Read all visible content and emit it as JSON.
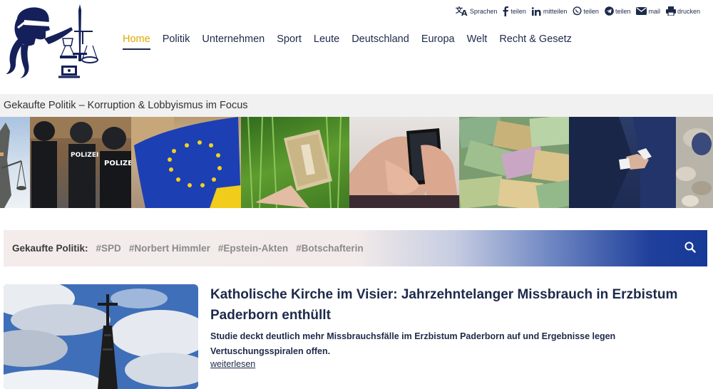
{
  "share": {
    "translate": "Sprachen",
    "facebook": "teilen",
    "linkedin": "mitteilen",
    "whatsapp": "teilen",
    "telegram": "teilen",
    "mail": "mail",
    "print": "drucken"
  },
  "nav": {
    "items": [
      "Home",
      "Politik",
      "Unternehmen",
      "Sport",
      "Leute",
      "Deutschland",
      "Europa",
      "Welt",
      "Recht & Gesetz"
    ]
  },
  "tagline": "Gekaufte Politik – Korruption & Lobbyismus im Focus",
  "banner": {
    "police_text": "POLIZEI"
  },
  "tagbar": {
    "label": "Gekaufte Politik:",
    "tags": [
      "#SPD",
      "#Norbert Himmler",
      "#Epstein-Akten",
      "#Botschafterin"
    ]
  },
  "article": {
    "title": "Katholische Kirche im Visier: Jahrzehntelanger Missbrauch in Erzbistum Paderborn enthüllt",
    "teaser": "Studie deckt deutlich mehr Missbrauchsfälle im Erzbistum Paderborn auf und Ergebnisse legen Vertuschungsspiralen offen.",
    "read_more": "weiterlesen"
  },
  "colors": {
    "navy": "#1d2a4a",
    "active_nav": "#e0a800",
    "tagbar_blue": "#173a97"
  },
  "icons": [
    "logo-justitia",
    "translate-icon",
    "facebook-icon",
    "linkedin-icon",
    "whatsapp-icon",
    "telegram-icon",
    "mail-icon",
    "print-icon",
    "search-icon"
  ]
}
